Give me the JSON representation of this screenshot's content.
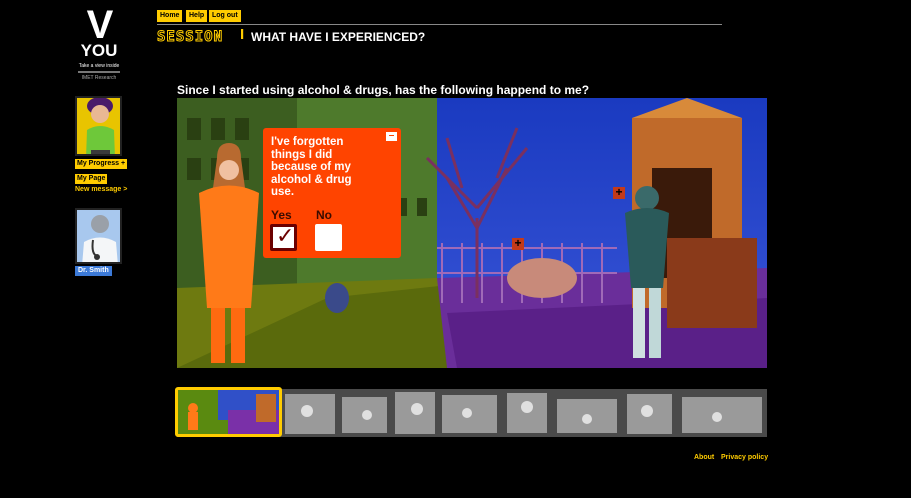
{
  "logo": {
    "mark": "V",
    "name": "YOU",
    "tagline": "Take a view inside",
    "org": "IMET Research"
  },
  "sidebar": {
    "my_progress": "My Progress",
    "my_page": "My Page",
    "new_message": "New message >",
    "doctor_name": "Dr. Smith"
  },
  "nav": {
    "home": "Home",
    "help": "Help",
    "logout": "Log out"
  },
  "session": {
    "label": "SESSION",
    "number": "I",
    "title": "WHAT HAVE I EXPERIENCED?"
  },
  "question": "Since I started using alcohol & drugs, has the following happend to me?",
  "card": {
    "statement": "I've forgotten things I did because of my alcohol & drug use.",
    "yes_label": "Yes",
    "no_label": "No",
    "selected": "yes"
  },
  "footer": {
    "about": "About",
    "privacy": "Privacy policy"
  },
  "colors": {
    "accent": "#ffcc00",
    "card": "#ff4400",
    "doctor_badge": "#3c7ad8"
  }
}
